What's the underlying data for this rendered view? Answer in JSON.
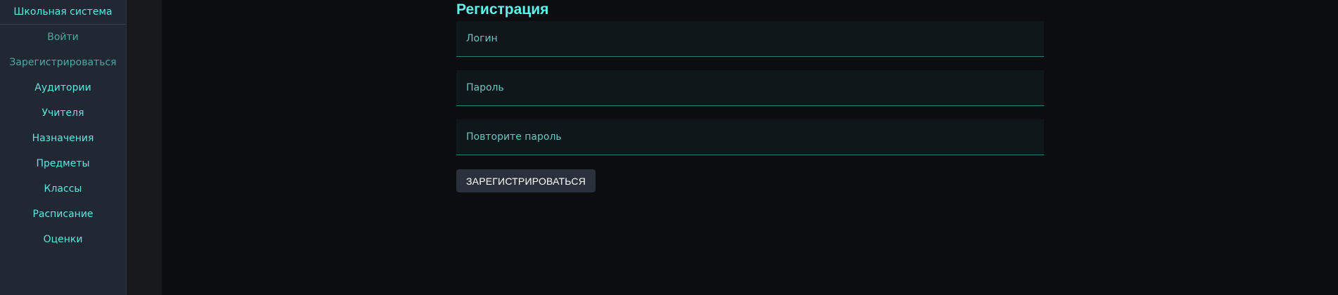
{
  "sidebar": {
    "brand": "Школьная система",
    "items": [
      {
        "label": "Войти",
        "muted": true
      },
      {
        "label": "Зарегистрироваться",
        "muted": true
      },
      {
        "label": "Аудитории",
        "muted": false
      },
      {
        "label": "Учителя",
        "muted": false
      },
      {
        "label": "Назначения",
        "muted": false
      },
      {
        "label": "Предметы",
        "muted": false
      },
      {
        "label": "Классы",
        "muted": false
      },
      {
        "label": "Расписание",
        "muted": false
      },
      {
        "label": "Оценки",
        "muted": false
      }
    ]
  },
  "form": {
    "title": "Регистрация",
    "login": {
      "value": "",
      "placeholder": "Логин"
    },
    "password": {
      "value": "",
      "placeholder": "Пароль"
    },
    "repeat_password": {
      "value": "",
      "placeholder": "Повторите пароль"
    },
    "submit_label": "ЗАРЕГИСТРИРОВАТЬСЯ"
  },
  "colors": {
    "accent": "#5fe6e0",
    "accent_muted": "#53a7a3",
    "sidebar_bg": "#202833",
    "page_bg": "#0b0d10",
    "field_bg": "#0f171a",
    "button_bg": "#2a313c"
  }
}
